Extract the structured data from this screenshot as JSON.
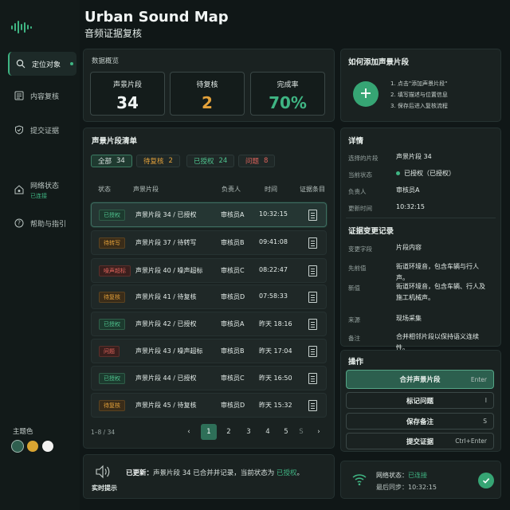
{
  "app": {
    "title": "Urban Sound Map",
    "subtitle": "音频证据复核"
  },
  "colors": {
    "accent": "#3fb583",
    "warning": "#e3a13a",
    "danger": "#e0645c"
  },
  "sidebar": {
    "items": [
      {
        "label": "定位对象",
        "icon": "search-icon"
      },
      {
        "label": "内容复核",
        "icon": "list-icon"
      },
      {
        "label": "提交证据",
        "icon": "shield-icon"
      },
      {
        "label": "网络状态",
        "sub": "已连接",
        "icon": "network-icon"
      },
      {
        "label": "帮助与指引",
        "icon": "help-icon"
      }
    ],
    "theme_label": "主题色",
    "theme_colors": [
      "#2f5f4f",
      "#d9a431",
      "#f2f2f0"
    ]
  },
  "overview": {
    "title": "数据概览",
    "stats": [
      {
        "label": "声景片段",
        "value": "34"
      },
      {
        "label": "待复核",
        "value": "2"
      },
      {
        "label": "完成率",
        "value": "70%"
      }
    ]
  },
  "howto": {
    "title": "如何添加声景片段",
    "steps": [
      "1. 点击\"添加声景片段\"",
      "2. 填写描述与位置信息",
      "3. 保存后进入复核流程"
    ]
  },
  "list": {
    "title": "声景片段清单",
    "filters": [
      {
        "label": "全部",
        "count": "34"
      },
      {
        "label": "待复核",
        "count": "2"
      },
      {
        "label": "已授权",
        "count": "24"
      },
      {
        "label": "问题",
        "count": "8"
      }
    ],
    "headers": [
      "状态",
      "声景片段",
      "负责人",
      "时间",
      "证据条目"
    ],
    "rows": [
      {
        "status": "已授权",
        "tone": "green",
        "name": "声景片段 34 / 已授权",
        "owner": "审核员A",
        "time": "10:32:15"
      },
      {
        "status": "待转写",
        "tone": "orange",
        "name": "声景片段 37 / 待转写",
        "owner": "审核员B",
        "time": "09:41:08"
      },
      {
        "status": "噪声超标",
        "tone": "red",
        "name": "声景片段 40 / 噪声超标",
        "owner": "审核员C",
        "time": "08:22:47"
      },
      {
        "status": "待复核",
        "tone": "orange",
        "name": "声景片段 41 / 待复核",
        "owner": "审核员D",
        "time": "07:58:33"
      },
      {
        "status": "已授权",
        "tone": "green",
        "name": "声景片段 42 / 已授权",
        "owner": "审核员A",
        "time": "昨天 18:16"
      },
      {
        "status": "问题",
        "tone": "red",
        "name": "声景片段 43 / 噪声超标",
        "owner": "审核员B",
        "time": "昨天 17:04"
      },
      {
        "status": "已授权",
        "tone": "green",
        "name": "声景片段 44 / 已授权",
        "owner": "审核员C",
        "time": "昨天 16:50"
      },
      {
        "status": "待复核",
        "tone": "orange",
        "name": "声景片段 45 / 待复核",
        "owner": "审核员D",
        "time": "昨天 15:32"
      }
    ],
    "range": "1–8 / 34",
    "pages": [
      "1",
      "2",
      "3",
      "4",
      "5",
      "S"
    ]
  },
  "details": {
    "title": "详情",
    "fields": [
      {
        "k": "选择的片段",
        "v": "声景片段 34"
      },
      {
        "k": "当前状态",
        "v": "已授权（已授权）"
      },
      {
        "k": "负责人",
        "v": "审核员A"
      },
      {
        "k": "更新时间",
        "v": "10:32:15"
      }
    ],
    "changes_title": "证据变更记录",
    "changes": [
      {
        "k": "变更字段",
        "v": "片段内容"
      },
      {
        "k": "先前值",
        "v": "街道环境音，包含车辆与行人声。"
      },
      {
        "k": "新值",
        "v": "街道环境音，包含车辆、行人及施工机械声。"
      },
      {
        "k": "来源",
        "v": "现场采集"
      },
      {
        "k": "备注",
        "v": "合并相邻片段以保持语义连续性。"
      }
    ]
  },
  "actions": {
    "title": "操作",
    "items": [
      {
        "label": "合并声景片段",
        "key": "Enter"
      },
      {
        "label": "标记问题",
        "key": "I"
      },
      {
        "label": "保存备注",
        "key": "S"
      },
      {
        "label": "提交证据",
        "key": "Ctrl+Enter"
      }
    ]
  },
  "toast": {
    "label": "实时提示",
    "prefix": "已更新：",
    "text": "声景片段 34 已合并并记录，当前状态为",
    "status": "已授权",
    "suffix": "。"
  },
  "network": {
    "label": "网络状态：",
    "status": "已连接",
    "sync_label": "最后同步：",
    "sync_time": "10:32:15"
  }
}
